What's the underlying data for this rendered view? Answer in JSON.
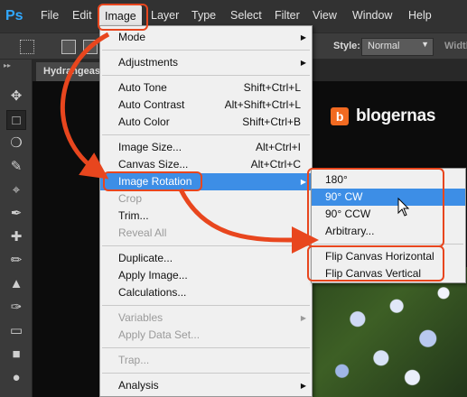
{
  "app": {
    "logo": "Ps"
  },
  "menubar": {
    "items": [
      "File",
      "Edit",
      "Image",
      "Layer",
      "Type",
      "Select",
      "Filter",
      "View",
      "Window",
      "Help"
    ],
    "active": "Image"
  },
  "options": {
    "style_label": "Style:",
    "style_value": "Normal",
    "width_label": "Width"
  },
  "tab": {
    "title": "Hydrangeas"
  },
  "brand": {
    "icon_letter": "b",
    "text": "blogernas"
  },
  "image_menu": [
    {
      "label": "Mode",
      "shortcut": "",
      "submenu": true,
      "disabled": false
    },
    {
      "sep": true
    },
    {
      "label": "Adjustments",
      "shortcut": "",
      "submenu": true,
      "disabled": false
    },
    {
      "sep": true
    },
    {
      "label": "Auto Tone",
      "shortcut": "Shift+Ctrl+L",
      "disabled": false
    },
    {
      "label": "Auto Contrast",
      "shortcut": "Alt+Shift+Ctrl+L",
      "disabled": false
    },
    {
      "label": "Auto Color",
      "shortcut": "Shift+Ctrl+B",
      "disabled": false
    },
    {
      "sep": true
    },
    {
      "label": "Image Size...",
      "shortcut": "Alt+Ctrl+I",
      "disabled": false
    },
    {
      "label": "Canvas Size...",
      "shortcut": "Alt+Ctrl+C",
      "disabled": false
    },
    {
      "label": "Image Rotation",
      "shortcut": "",
      "submenu": true,
      "disabled": false,
      "highlighted": true
    },
    {
      "label": "Crop",
      "shortcut": "",
      "disabled": true
    },
    {
      "label": "Trim...",
      "shortcut": "",
      "disabled": false
    },
    {
      "label": "Reveal All",
      "shortcut": "",
      "disabled": true
    },
    {
      "sep": true
    },
    {
      "label": "Duplicate...",
      "shortcut": "",
      "disabled": false
    },
    {
      "label": "Apply Image...",
      "shortcut": "",
      "disabled": false
    },
    {
      "label": "Calculations...",
      "shortcut": "",
      "disabled": false
    },
    {
      "sep": true
    },
    {
      "label": "Variables",
      "shortcut": "",
      "submenu": true,
      "disabled": true
    },
    {
      "label": "Apply Data Set...",
      "shortcut": "",
      "disabled": true
    },
    {
      "sep": true
    },
    {
      "label": "Trap...",
      "shortcut": "",
      "disabled": true
    },
    {
      "sep": true
    },
    {
      "label": "Analysis",
      "shortcut": "",
      "submenu": true,
      "disabled": false
    }
  ],
  "rotation_menu": [
    {
      "label": "180°",
      "highlighted": false
    },
    {
      "label": "90° CW",
      "highlighted": true
    },
    {
      "label": "90° CCW",
      "highlighted": false
    },
    {
      "label": "Arbitrary...",
      "highlighted": false
    },
    {
      "sep": true
    },
    {
      "label": "Flip Canvas Horizontal",
      "highlighted": false
    },
    {
      "label": "Flip Canvas Vertical",
      "highlighted": false
    }
  ],
  "colors": {
    "highlight": "#3d8ee6",
    "annotation": "#e8461e",
    "menubar": "#323232",
    "brand_icon": "#f26a21"
  },
  "tools": [
    "move-icon",
    "marquee-icon",
    "lasso-icon",
    "quick-select-icon",
    "crop-icon",
    "eyedropper-icon",
    "healing-icon",
    "brush-icon",
    "stamp-icon",
    "history-brush-icon",
    "eraser-icon",
    "gradient-icon",
    "blur-icon"
  ]
}
